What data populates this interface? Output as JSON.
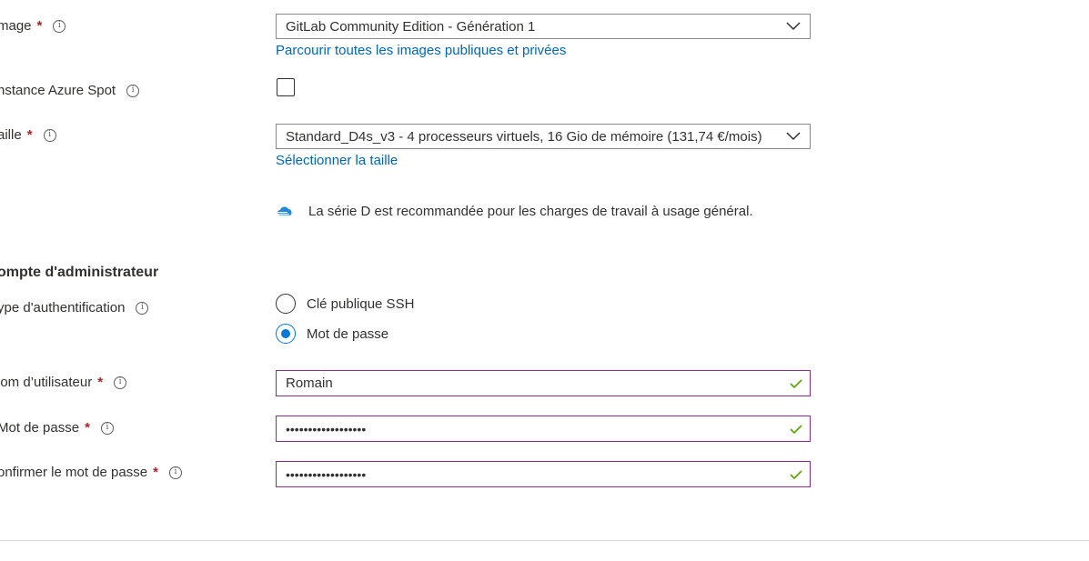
{
  "image": {
    "label": "mage",
    "required": "*",
    "info_icon": "i",
    "value": "GitLab Community Edition - Génération 1",
    "browse_link": "Parcourir toutes les images publiques et privées"
  },
  "spot": {
    "label": "nstance Azure Spot",
    "info_icon": "i",
    "checked": false
  },
  "size": {
    "label": "aille",
    "required": "*",
    "info_icon": "i",
    "value": "Standard_D4s_v3 - 4 processeurs virtuels, 16 Gio de mémoire (131,74 €/mois)",
    "select_link": "Sélectionner la taille",
    "info_message": "La série D est recommandée pour les charges de travail à usage général."
  },
  "admin": {
    "section_title": "ompte d'administrateur",
    "auth_type": {
      "label": "ype d'authentification",
      "info_icon": "i",
      "options": [
        {
          "label": "Clé publique SSH",
          "checked": false
        },
        {
          "label": "Mot de passe",
          "checked": true
        }
      ]
    },
    "username": {
      "label": "lom d’utilisateur",
      "required": "*",
      "info_icon": "i",
      "value": "Romain"
    },
    "password": {
      "label": "Mot de passe",
      "required": "*",
      "info_icon": "i",
      "value": "••••••••••••••••••"
    },
    "confirm_password": {
      "label": "onfirmer le mot de passe",
      "required": "*",
      "info_icon": "i",
      "value": "••••••••••••••••••"
    }
  },
  "icons": {
    "chevron": "chevron-down-icon",
    "check": "checkmark-icon",
    "cloud": "cloud-info-icon"
  },
  "colors": {
    "link": "#0067b8",
    "required": "#a4262c",
    "valid_border": "#8c2d8e",
    "valid_check": "#57a300",
    "radio_accent": "#0078d4"
  }
}
